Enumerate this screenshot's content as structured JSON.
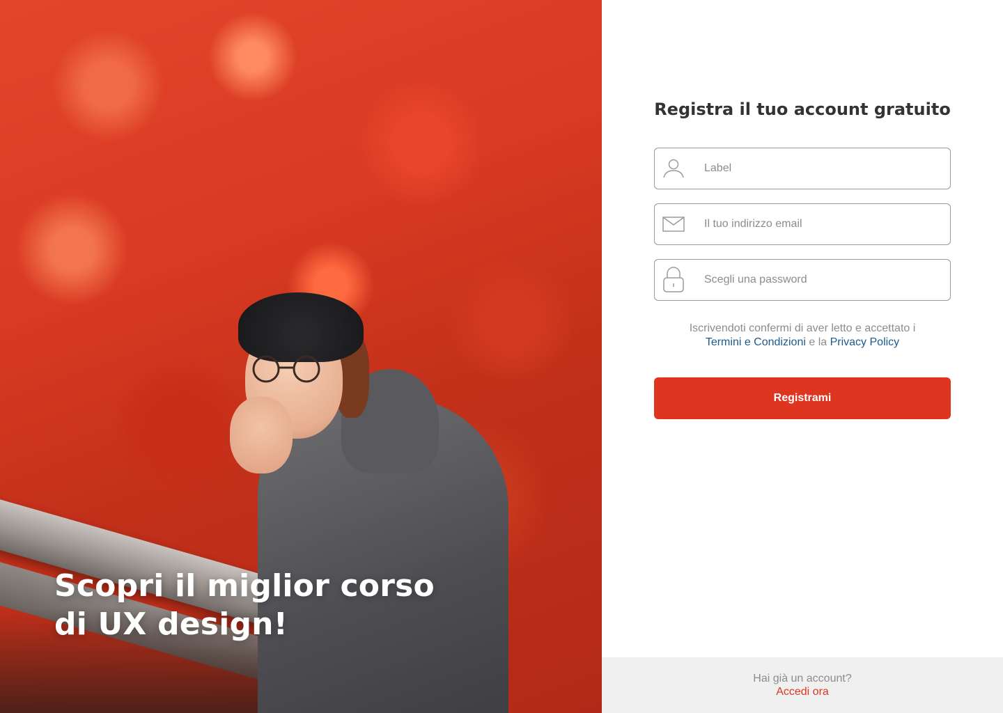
{
  "hero": {
    "headline_line1": "Scopri il miglior corso",
    "headline_line2": "di UX design!"
  },
  "form": {
    "title": "Registra il tuo account gratuito",
    "fields": [
      {
        "icon": "user-icon",
        "placeholder": "Label",
        "value": ""
      },
      {
        "icon": "envelope-icon",
        "placeholder": "Il tuo indirizzo email",
        "value": ""
      },
      {
        "icon": "lock-icon",
        "placeholder": "Scegli una password",
        "value": ""
      }
    ],
    "terms": {
      "prefix": "Iscrivendoti confermi di aver letto e accettato i",
      "terms_link": "Termini e Condizioni",
      "connector": "e la",
      "privacy_link": "Privacy Policy"
    },
    "submit_label": "Registrami"
  },
  "footer": {
    "question": "Hai già un account?",
    "login_link": "Accedi ora"
  },
  "colors": {
    "accent": "#de3520",
    "link": "#1c5a8c",
    "muted_text": "#8c8c8c",
    "footer_bg": "#f0f0f0"
  }
}
